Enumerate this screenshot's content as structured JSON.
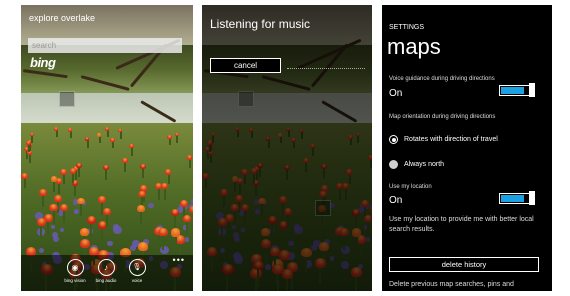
{
  "screen1": {
    "title": "explore overlake",
    "search_placeholder": "search",
    "bing_logo": "bing",
    "appbar": [
      {
        "icon": "eye-icon",
        "glyph": "◉",
        "label": "bing vision"
      },
      {
        "icon": "music-note-icon",
        "glyph": "♪",
        "label": "bing audio"
      },
      {
        "icon": "microphone-icon",
        "glyph": "🎙",
        "label": "voice"
      }
    ],
    "more": "•••"
  },
  "screen2": {
    "title": "Listening for music",
    "cancel_label": "cancel"
  },
  "screen3": {
    "header": "SETTINGS",
    "page_title": "maps",
    "voice_guidance_label": "Voice guidance during driving directions",
    "voice_guidance_value": "On",
    "orientation_label": "Map orientation during driving directions",
    "orientation_options": [
      "Rotates with direction of travel",
      "Always north"
    ],
    "orientation_selected": 0,
    "location_label": "Use my location",
    "location_value": "On",
    "location_description": "Use my location to provide me with better local search results.",
    "delete_history_label": "delete history",
    "cut_off_text": "Delete previous map searches, pins and"
  },
  "colors": {
    "accent": "#1ba1e2",
    "background": "#000000",
    "foreground": "#ffffff"
  }
}
